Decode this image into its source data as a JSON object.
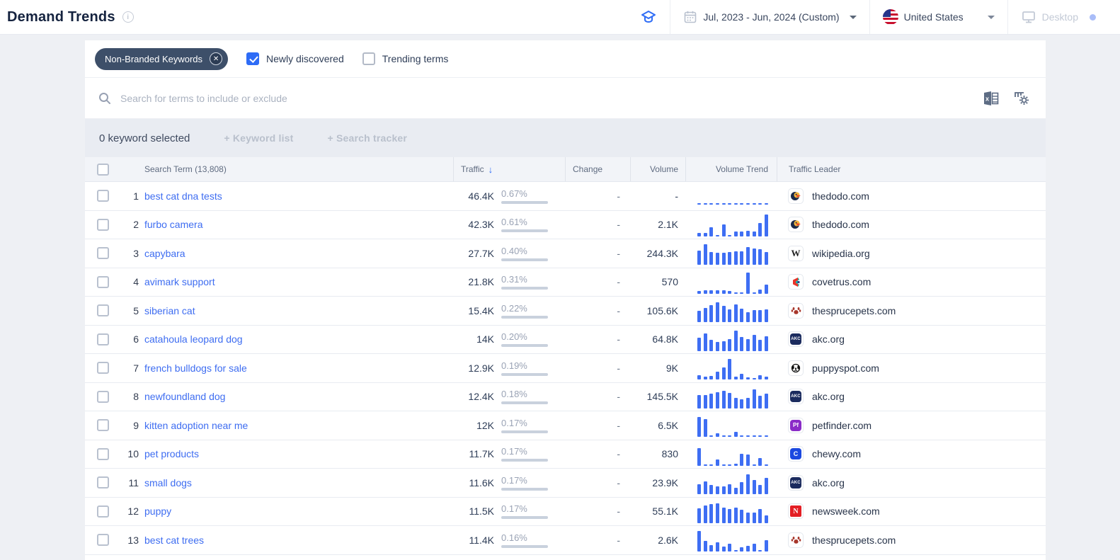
{
  "header": {
    "title": "Demand Trends",
    "date_range": "Jul, 2023 - Jun, 2024 (Custom)",
    "country": "United States",
    "device": "Desktop"
  },
  "filters": {
    "chip_label": "Non-Branded Keywords",
    "newly_discovered": {
      "label": "Newly discovered",
      "checked": true
    },
    "trending_terms": {
      "label": "Trending terms",
      "checked": false
    }
  },
  "search": {
    "placeholder": "Search for terms to include or exclude"
  },
  "toolbar_icons": [
    "excel-export-icon",
    "column-settings-icon"
  ],
  "selection_bar": {
    "selected_text": "0 keyword selected",
    "keyword_list_label": "+  Keyword list",
    "search_tracker_label": "+  Search tracker"
  },
  "table": {
    "columns": [
      "Search Term (13,808)",
      "Traffic",
      "Change",
      "Volume",
      "Volume Trend",
      "Traffic Leader"
    ],
    "sort_column": "Traffic",
    "sort_direction": "desc",
    "rows": [
      {
        "rank": 1,
        "term": "best cat dna tests",
        "traffic": "46.4K",
        "share": "0.67%",
        "change": "-",
        "volume": "-",
        "trend_type": "dashed",
        "trend": [
          3,
          3,
          3,
          3,
          3,
          3,
          3,
          3,
          3,
          3,
          3,
          3
        ],
        "leader": "thedodo.com",
        "favicon": "thedodo"
      },
      {
        "rank": 2,
        "term": "furbo camera",
        "traffic": "42.3K",
        "share": "0.61%",
        "change": "-",
        "volume": "2.1K",
        "trend_type": "bars",
        "trend": [
          14,
          14,
          38,
          6,
          52,
          6,
          22,
          22,
          24,
          20,
          58,
          92
        ],
        "leader": "thedodo.com",
        "favicon": "thedodo"
      },
      {
        "rank": 3,
        "term": "capybara",
        "traffic": "27.7K",
        "share": "0.40%",
        "change": "-",
        "volume": "244.3K",
        "trend_type": "bars",
        "trend": [
          62,
          90,
          55,
          52,
          52,
          55,
          58,
          58,
          78,
          72,
          68,
          56
        ],
        "leader": "wikipedia.org",
        "favicon": "wikipedia"
      },
      {
        "rank": 4,
        "term": "avimark support",
        "traffic": "21.8K",
        "share": "0.31%",
        "change": "-",
        "volume": "570",
        "trend_type": "bars",
        "trend": [
          12,
          14,
          14,
          15,
          14,
          12,
          4,
          4,
          90,
          4,
          16,
          38
        ],
        "leader": "covetrus.com",
        "favicon": "covetrus"
      },
      {
        "rank": 5,
        "term": "siberian cat",
        "traffic": "15.4K",
        "share": "0.22%",
        "change": "-",
        "volume": "105.6K",
        "trend_type": "bars",
        "trend": [
          50,
          60,
          75,
          85,
          70,
          55,
          78,
          58,
          42,
          52,
          52,
          55
        ],
        "leader": "thesprucepets.com",
        "favicon": "sprucepets"
      },
      {
        "rank": 6,
        "term": "catahoula leopard dog",
        "traffic": "14K",
        "share": "0.20%",
        "change": "-",
        "volume": "64.8K",
        "trend_type": "bars",
        "trend": [
          58,
          75,
          48,
          40,
          42,
          50,
          88,
          60,
          52,
          68,
          48,
          62
        ],
        "leader": "akc.org",
        "favicon": "akc"
      },
      {
        "rank": 7,
        "term": "french bulldogs for sale",
        "traffic": "12.9K",
        "share": "0.19%",
        "change": "-",
        "volume": "9K",
        "trend_type": "bars",
        "trend": [
          20,
          13,
          17,
          33,
          52,
          90,
          13,
          25,
          10,
          5,
          20,
          13
        ],
        "leader": "puppyspot.com",
        "favicon": "puppyspot"
      },
      {
        "rank": 8,
        "term": "newfoundland dog",
        "traffic": "12.4K",
        "share": "0.18%",
        "change": "-",
        "volume": "145.5K",
        "trend_type": "bars",
        "trend": [
          58,
          58,
          62,
          70,
          74,
          66,
          46,
          40,
          46,
          80,
          54,
          64
        ],
        "leader": "akc.org",
        "favicon": "akc"
      },
      {
        "rank": 9,
        "term": "kitten adoption near me",
        "traffic": "12K",
        "share": "0.17%",
        "change": "-",
        "volume": "6.5K",
        "trend_type": "bars",
        "trend": [
          85,
          78,
          4,
          15,
          8,
          8,
          22,
          5,
          4,
          4,
          4,
          4
        ],
        "leader": "petfinder.com",
        "favicon": "petfinder"
      },
      {
        "rank": 10,
        "term": "pet products",
        "traffic": "11.7K",
        "share": "0.17%",
        "change": "-",
        "volume": "830",
        "trend_type": "bars",
        "trend": [
          75,
          4,
          4,
          28,
          4,
          4,
          8,
          52,
          48,
          4,
          34,
          4
        ],
        "leader": "chewy.com",
        "favicon": "chewy"
      },
      {
        "rank": 11,
        "term": "small dogs",
        "traffic": "11.6K",
        "share": "0.17%",
        "change": "-",
        "volume": "23.9K",
        "trend_type": "bars",
        "trend": [
          42,
          55,
          40,
          35,
          35,
          42,
          28,
          52,
          85,
          62,
          40,
          70
        ],
        "leader": "akc.org",
        "favicon": "akc"
      },
      {
        "rank": 12,
        "term": "puppy",
        "traffic": "11.5K",
        "share": "0.17%",
        "change": "-",
        "volume": "55.1K",
        "trend_type": "bars",
        "trend": [
          62,
          75,
          80,
          85,
          66,
          60,
          66,
          56,
          46,
          46,
          60,
          32
        ],
        "leader": "newsweek.com",
        "favicon": "newsweek"
      },
      {
        "rank": 13,
        "term": "best cat trees",
        "traffic": "11.4K",
        "share": "0.16%",
        "change": "-",
        "volume": "2.6K",
        "trend_type": "bars",
        "trend": [
          90,
          45,
          28,
          40,
          22,
          35,
          4,
          18,
          25,
          35,
          8,
          50
        ],
        "leader": "thesprucepets.com",
        "favicon": "sprucepets"
      }
    ]
  },
  "colors": {
    "accent_blue": "#2e6cf6",
    "link_blue": "#3e6df1",
    "bar_blue": "#3e6ef3",
    "chip_dark": "#3d4f69",
    "page_bg": "#eef0f4",
    "selection_bar_bg": "#e9ecf2"
  }
}
